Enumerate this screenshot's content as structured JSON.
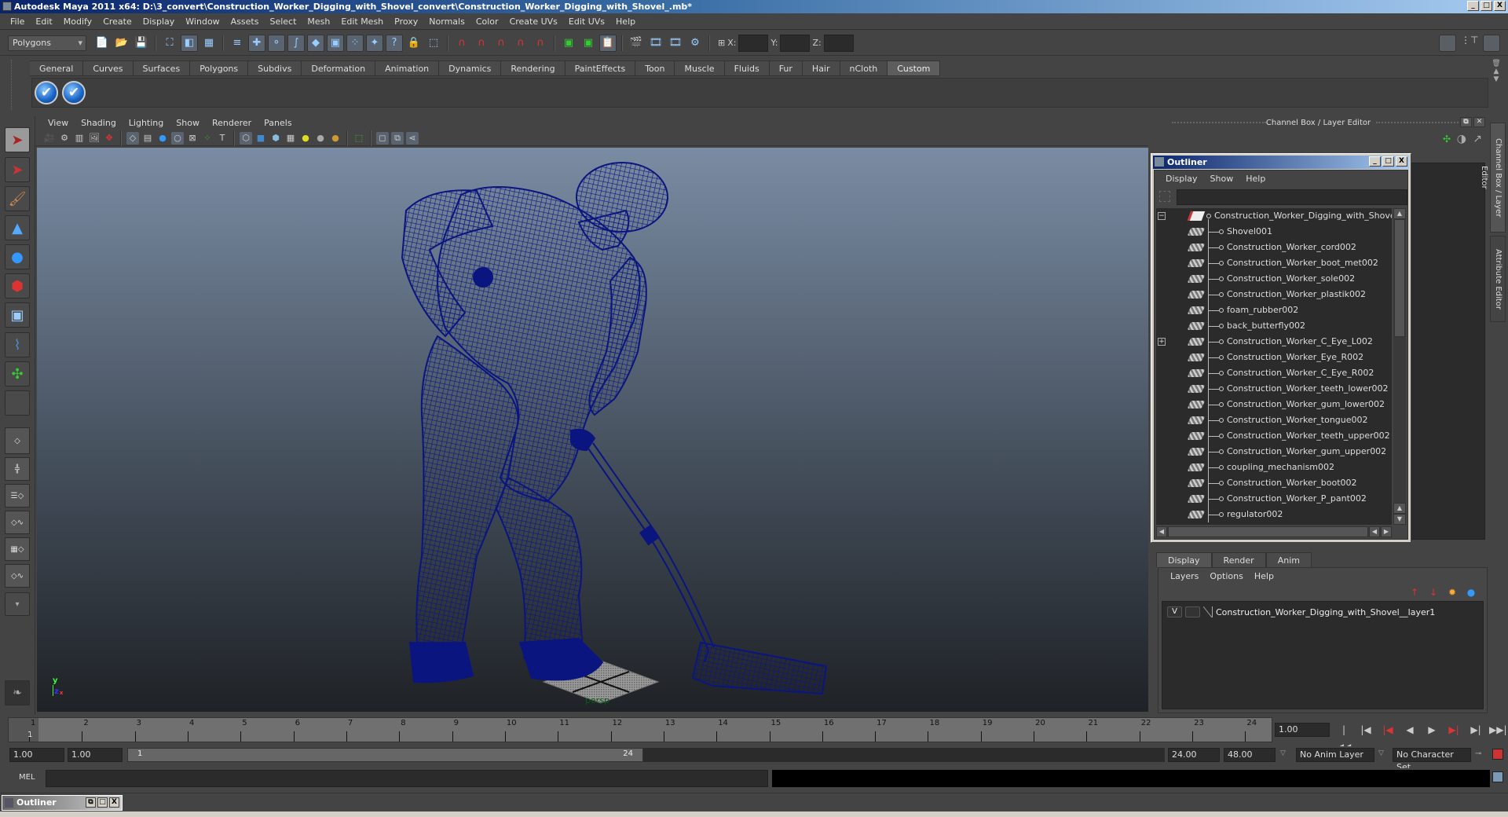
{
  "window": {
    "title": "Autodesk Maya 2011 x64: D:\\3_convert\\Construction_Worker_Digging_with_Shovel_convert\\Construction_Worker_Digging_with_Shovel_.mb*",
    "minimize": "_",
    "maximize": "□",
    "close": "X"
  },
  "menubar": [
    "File",
    "Edit",
    "Modify",
    "Create",
    "Display",
    "Window",
    "Assets",
    "Select",
    "Mesh",
    "Edit Mesh",
    "Proxy",
    "Normals",
    "Color",
    "Create UVs",
    "Edit UVs",
    "Help"
  ],
  "statusline": {
    "mode": "Polygons",
    "x_label": "X:",
    "y_label": "Y:",
    "z_label": "Z:"
  },
  "shelf": {
    "tabs": [
      "General",
      "Curves",
      "Surfaces",
      "Polygons",
      "Subdivs",
      "Deformation",
      "Animation",
      "Dynamics",
      "Rendering",
      "PaintEffects",
      "Toon",
      "Muscle",
      "Fluids",
      "Fur",
      "Hair",
      "nCloth",
      "Custom"
    ],
    "active_tab": "Custom",
    "icons": [
      "checkmark-icon",
      "checkmark-icon"
    ]
  },
  "viewport": {
    "menu": [
      "View",
      "Shading",
      "Lighting",
      "Show",
      "Renderer",
      "Panels"
    ],
    "camera_label": "persp",
    "axis": {
      "y": "y",
      "z": "z",
      "x": "x"
    }
  },
  "channel_box": {
    "title": "Channel Box / Layer Editor"
  },
  "right_tabs": [
    "Channel Box / Layer Editor",
    "Attribute Editor"
  ],
  "outliner": {
    "title": "Outliner",
    "menu": [
      "Display",
      "Show",
      "Help"
    ],
    "filter_value": "",
    "root": "Construction_Worker_Digging_with_Shovel",
    "items": [
      "Shovel001",
      "Construction_Worker_cord002",
      "Construction_Worker_boot_met002",
      "Construction_Worker_sole002",
      "Construction_Worker_plastik002",
      "foam_rubber002",
      "back_butterfly002",
      "Construction_Worker_C_Eye_L002",
      "Construction_Worker_Eye_R002",
      "Construction_Worker_C_Eye_R002",
      "Construction_Worker_teeth_lower002",
      "Construction_Worker_gum_lower002",
      "Construction_Worker_tongue002",
      "Construction_Worker_teeth_upper002",
      "Construction_Worker_gum_upper002",
      "coupling_mechanism002",
      "Construction_Worker_boot002",
      "Construction_Worker_P_pant002",
      "regulator002"
    ],
    "expandable_index": 7
  },
  "layer_editor": {
    "tabs": [
      "Display",
      "Render",
      "Anim"
    ],
    "active_tab": "Display",
    "menu": [
      "Layers",
      "Options",
      "Help"
    ],
    "layers": [
      {
        "visible": "V",
        "playback": "",
        "name": "Construction_Worker_Digging_with_Shovel__layer1"
      }
    ]
  },
  "timeline": {
    "ticks": [
      "1",
      "2",
      "3",
      "4",
      "5",
      "6",
      "7",
      "8",
      "9",
      "10",
      "11",
      "12",
      "13",
      "14",
      "15",
      "16",
      "17",
      "18",
      "19",
      "20",
      "21",
      "22",
      "23",
      "24"
    ],
    "current_marker": "1",
    "current_frame": "1.00"
  },
  "range": {
    "start_time": "1.00",
    "playback_start": "1.00",
    "slider_start": "1",
    "slider_end": "24",
    "playback_end": "24.00",
    "end_time": "48.00",
    "anim_layer": "No Anim Layer",
    "character_set": "No Character Set"
  },
  "command_line": {
    "label": "MEL",
    "value": ""
  },
  "minimized_window": {
    "title": "Outliner"
  }
}
